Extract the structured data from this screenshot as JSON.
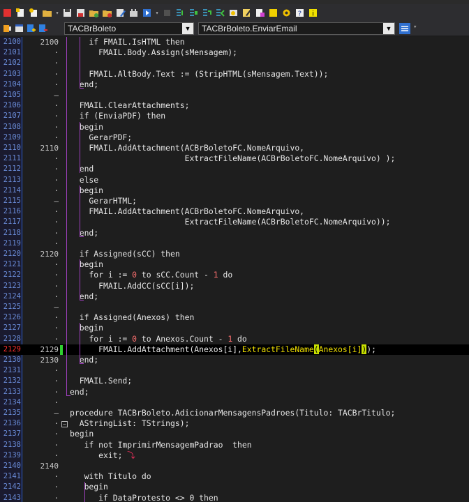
{
  "toolbar": {
    "icons": [
      "stop-icon",
      "new-file-icon",
      "new-item-icon",
      "open-icon",
      "dropdown-icon",
      "save-icon",
      "save-all-icon",
      "open-project-icon",
      "close-icon",
      "edit-icon",
      "app-icon",
      "run-icon",
      "dropdown-icon",
      "stop-run-icon",
      "step-icon",
      "step-over-icon",
      "step-into-icon",
      "step-out-icon",
      "view-icon",
      "edit-doc-icon",
      "find-icon",
      "notes-icon",
      "options-icon",
      "help-icon",
      "info-icon"
    ]
  },
  "combos": {
    "class_combo": "TACBrBoleto",
    "method_combo": "TACBrBoleto.EnviarEmail"
  },
  "editor": {
    "lines": [
      {
        "n": "2100",
        "mk": "2100",
        "code": "    if FMAIL.IsHTML then"
      },
      {
        "n": "2101",
        "mk": "·",
        "code": "      FMAIL.Body.Assign(sMensagem);"
      },
      {
        "n": "2102",
        "mk": "·",
        "code": ""
      },
      {
        "n": "2103",
        "mk": "·",
        "code": "    FMAIL.AltBody.Text := (StripHTML(sMensagem.Text));"
      },
      {
        "n": "2104",
        "mk": "·",
        "code": "  end;"
      },
      {
        "n": "2105",
        "mk": "–",
        "code": ""
      },
      {
        "n": "2106",
        "mk": "·",
        "code": "  FMAIL.ClearAttachments;"
      },
      {
        "n": "2107",
        "mk": "·",
        "code": "  if (EnviaPDF) then"
      },
      {
        "n": "2108",
        "mk": "·",
        "code": "  begin"
      },
      {
        "n": "2109",
        "mk": "·",
        "code": "    GerarPDF;"
      },
      {
        "n": "2110",
        "mk": "2110",
        "code": "    FMAIL.AddAttachment(ACBrBoletoFC.NomeArquivo,"
      },
      {
        "n": "2111",
        "mk": "·",
        "code": "                        ExtractFileName(ACBrBoletoFC.NomeArquivo) );"
      },
      {
        "n": "2112",
        "mk": "·",
        "code": "  end"
      },
      {
        "n": "2113",
        "mk": "·",
        "code": "  else"
      },
      {
        "n": "2114",
        "mk": "·",
        "code": "  begin"
      },
      {
        "n": "2115",
        "mk": "–",
        "code": "    GerarHTML;"
      },
      {
        "n": "2116",
        "mk": "·",
        "code": "    FMAIL.AddAttachment(ACBrBoletoFC.NomeArquivo,"
      },
      {
        "n": "2117",
        "mk": "·",
        "code": "                        ExtractFileName(ACBrBoletoFC.NomeArquivo));"
      },
      {
        "n": "2118",
        "mk": "·",
        "code": "  end;"
      },
      {
        "n": "2119",
        "mk": "·",
        "code": ""
      },
      {
        "n": "2120",
        "mk": "2120",
        "code": "  if Assigned(sCC) then"
      },
      {
        "n": "2121",
        "mk": "·",
        "code": "  begin"
      },
      {
        "n": "2122",
        "mk": "·",
        "code": "    for i := 0 to sCC.Count - 1 do"
      },
      {
        "n": "2123",
        "mk": "·",
        "code": "      FMAIL.AddCC(sCC[i]);"
      },
      {
        "n": "2124",
        "mk": "·",
        "code": "  end;"
      },
      {
        "n": "2125",
        "mk": "–",
        "code": ""
      },
      {
        "n": "2126",
        "mk": "·",
        "code": "  if Assigned(Anexos) then"
      },
      {
        "n": "2127",
        "mk": "·",
        "code": "  begin"
      },
      {
        "n": "2128",
        "mk": "·",
        "code": "    for i := 0 to Anexos.Count - 1 do"
      },
      {
        "n": "2129",
        "mk": "2129",
        "code": "      FMAIL.AddAttachment(Anexos[i],ExtractFileName(Anexos[i]));"
      },
      {
        "n": "2130",
        "mk": "2130",
        "code": "  end;"
      },
      {
        "n": "2131",
        "mk": "·",
        "code": ""
      },
      {
        "n": "2132",
        "mk": "·",
        "code": "  FMAIL.Send;"
      },
      {
        "n": "2133",
        "mk": "·",
        "code": "end;"
      },
      {
        "n": "2134",
        "mk": "·",
        "code": ""
      },
      {
        "n": "2135",
        "mk": "–",
        "code": "procedure TACBrBoleto.AdicionarMensagensPadroes(Titulo: TACBrTitulo;"
      },
      {
        "n": "2136",
        "mk": "·",
        "code": "  AStringList: TStrings);"
      },
      {
        "n": "2137",
        "mk": "·",
        "code": "begin"
      },
      {
        "n": "2138",
        "mk": "·",
        "code": "   if not ImprimirMensagemPadrao  then"
      },
      {
        "n": "2139",
        "mk": "·",
        "code": "      exit;"
      },
      {
        "n": "2140",
        "mk": "2140",
        "code": ""
      },
      {
        "n": "2141",
        "mk": "·",
        "code": "   with Titulo do"
      },
      {
        "n": "2142",
        "mk": "·",
        "code": "   begin"
      },
      {
        "n": "2143",
        "mk": "·",
        "code": "      if DataProtesto <> 0 then"
      }
    ],
    "active_line": "2129"
  },
  "colors": {
    "background": "#1e1e1e",
    "gutter_numbers": "#6a8cd8",
    "active_line_number": "#ff3030",
    "number_literal": "#ff7070",
    "block_highlight": "#c8e000",
    "fold_line": "#a040c0"
  }
}
